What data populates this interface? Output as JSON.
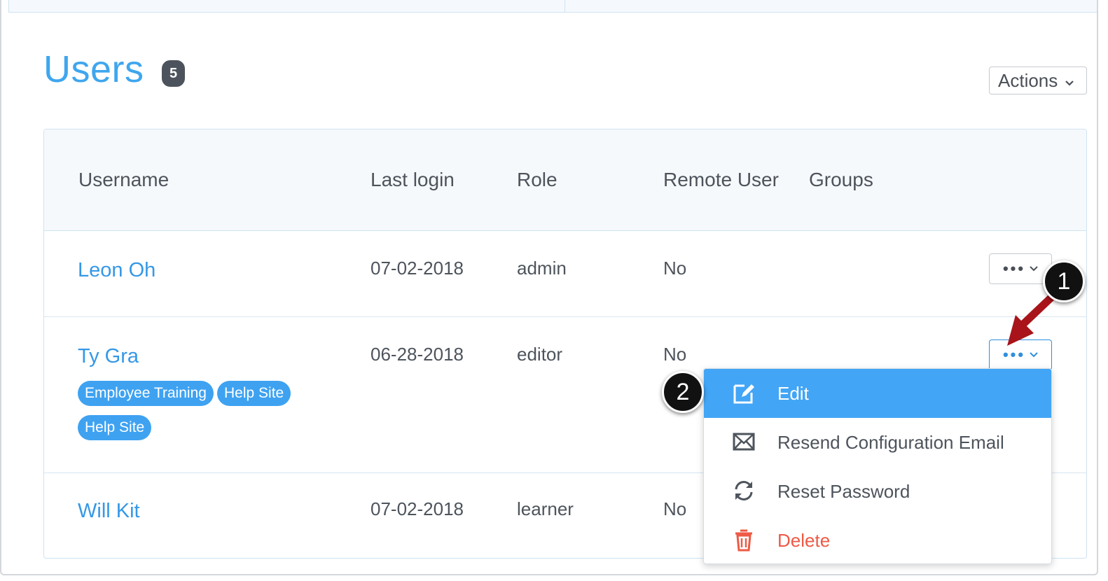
{
  "header": {
    "title": "Users",
    "count": "5",
    "actions_label": "Actions"
  },
  "table": {
    "columns": [
      "Username",
      "Last login",
      "Role",
      "Remote User",
      "Groups"
    ],
    "rows": [
      {
        "username": "Leon Oh",
        "last_login": "07-02-2018",
        "role": "admin",
        "remote_user": "No",
        "groups": []
      },
      {
        "username": "Ty Gra",
        "last_login": "06-28-2018",
        "role": "editor",
        "remote_user": "No",
        "groups": [
          "Employee Training",
          "Help Site",
          "Help Site"
        ]
      },
      {
        "username": "Will Kit",
        "last_login": "07-02-2018",
        "role": "learner",
        "remote_user": "No",
        "groups": []
      }
    ]
  },
  "row_menu": {
    "items": [
      {
        "label": "Edit",
        "icon": "edit-icon"
      },
      {
        "label": "Resend Configuration Email",
        "icon": "envelope-icon"
      },
      {
        "label": "Reset Password",
        "icon": "refresh-icon"
      },
      {
        "label": "Delete",
        "icon": "trash-icon"
      }
    ]
  },
  "callouts": [
    "1",
    "2"
  ],
  "colors": {
    "accent": "#3fa6ee",
    "menu_selected": "#42a5f5",
    "danger": "#ee5a45",
    "callout_arrow": "#a8141a"
  }
}
